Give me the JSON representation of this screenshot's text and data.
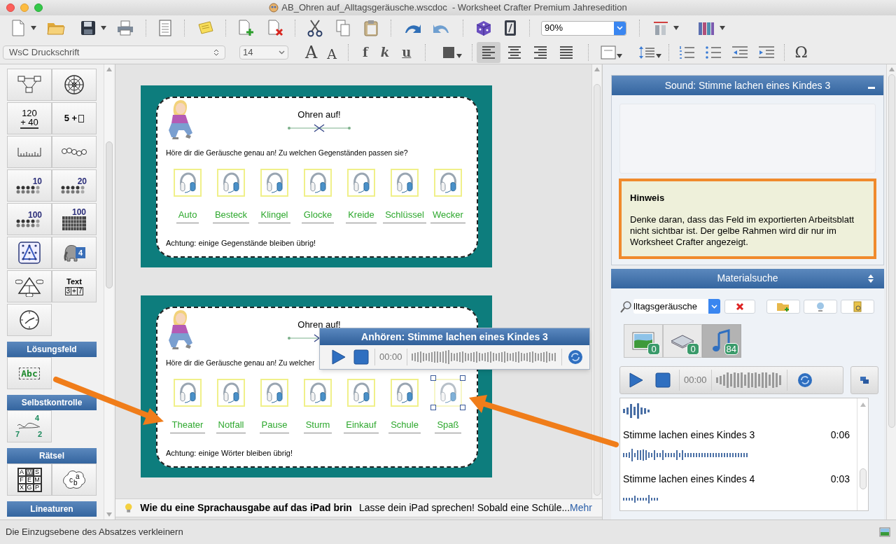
{
  "window": {
    "title": "AB_Ohren auf_Alltagsgeräusche.wscdoc  - Worksheet Crafter Premium Jahresedition"
  },
  "toolbar": {
    "zoom": "90%"
  },
  "format_bar": {
    "font": "WsC Druckschrift",
    "size": "14",
    "size_buttons": [
      "A",
      "A"
    ],
    "style_buttons": [
      "f",
      "k",
      "u"
    ],
    "align_buttons": [
      {
        "selected": true
      },
      {
        "selected": false
      },
      {
        "selected": false
      },
      {
        "selected": false
      }
    ],
    "special_char": "Ω"
  },
  "palette": {
    "tools": [
      {
        "kind": "flowchart"
      },
      {
        "kind": "wheel"
      },
      {
        "kind": "column-sum",
        "texts": [
          "120",
          "+ 40"
        ]
      },
      {
        "kind": "equation",
        "texts": [
          "5 +"
        ]
      },
      {
        "kind": "ruler"
      },
      {
        "kind": "beads"
      },
      {
        "kind": "dots",
        "texts": [
          "10"
        ]
      },
      {
        "kind": "dots",
        "texts": [
          "20"
        ]
      },
      {
        "kind": "dots",
        "texts": [
          "100"
        ]
      },
      {
        "kind": "grid",
        "texts": [
          "100"
        ]
      },
      {
        "kind": "geoboard"
      },
      {
        "kind": "elephant",
        "texts": [
          "4"
        ]
      },
      {
        "kind": "triangle"
      },
      {
        "kind": "text-task",
        "texts": [
          "Text",
          "3",
          "+",
          "7"
        ]
      },
      {
        "kind": "clock"
      }
    ],
    "sections": [
      {
        "title": "Lösungsfeld",
        "tools": [
          {
            "kind": "answer",
            "texts": [
              "Abc"
            ]
          }
        ]
      },
      {
        "title": "Selbstkontrolle",
        "tools": [
          {
            "kind": "self-check",
            "texts": [
              "4",
              "7",
              "2"
            ]
          }
        ]
      },
      {
        "title": "Rätsel",
        "tools": [
          {
            "kind": "letter-grid",
            "texts": [
              "A",
              "W",
              "S",
              "F",
              "E",
              "M",
              "X",
              "G",
              "P"
            ]
          },
          {
            "kind": "cloud",
            "texts": [
              "c",
              "b",
              "a"
            ]
          }
        ]
      },
      {
        "title": "Lineaturen"
      }
    ]
  },
  "worksheets": [
    {
      "title": "Ohren auf!",
      "instruction": "Höre dir die Geräusche genau an! Zu welchen Gegenständen passen sie?",
      "sound_fields": [
        {
          "selected": false
        },
        {
          "selected": false
        },
        {
          "selected": false
        },
        {
          "selected": false
        },
        {
          "selected": false
        },
        {
          "selected": false
        },
        {
          "selected": false
        }
      ],
      "words": [
        "Auto",
        "Besteck",
        "Klingel",
        "Glocke",
        "Kreide",
        "Schlüssel",
        "Wecker"
      ],
      "note": "Achtung: einige Gegenstände bleiben übrig!"
    },
    {
      "title": "Ohren auf!",
      "instruction": "Höre dir die Geräusche genau an! Zu welcher",
      "sound_fields": [
        {
          "selected": false
        },
        {
          "selected": false
        },
        {
          "selected": false
        },
        {
          "selected": false
        },
        {
          "selected": false
        },
        {
          "selected": false
        },
        {
          "selected": true
        }
      ],
      "words": [
        "Theater",
        "Notfall",
        "Pause",
        "Sturm",
        "Einkauf",
        "Schule",
        "Spaß"
      ],
      "note": "Achtung: einige Wörter bleiben übrig!"
    }
  ],
  "player_popup": {
    "title": "Anhören: Stimme lachen eines Kindes 3",
    "time": "00:00"
  },
  "tip": {
    "title": "Wie du eine Sprachausgabe auf das iPad brin",
    "text": "Lasse dein iPad sprechen! Sobald eine Schüle...",
    "link": "Mehr"
  },
  "sound_panel": {
    "title": "Sound: Stimme lachen eines Kindes 3",
    "hint": {
      "title": "Hinweis",
      "text": "Denke daran, dass das Feld im exportierten Arbeitsblatt nicht sichtbar ist. Der gelbe Rahmen wird dir nur im Worksheet Crafter angezeigt."
    }
  },
  "material_search": {
    "title": "Materialsuche",
    "query": "lltagsgeräusche",
    "categories": [
      {
        "kind": "images",
        "count": "0",
        "selected": false
      },
      {
        "kind": "books",
        "count": "0",
        "selected": false
      },
      {
        "kind": "sounds",
        "count": "84",
        "selected": true
      }
    ],
    "time": "00:00",
    "results": [
      {
        "name": "Stimme lachen eines Kindes 3",
        "duration": "0:06"
      },
      {
        "name": "Stimme lachen eines Kindes 4",
        "duration": "0:03"
      }
    ]
  },
  "status_bar": {
    "text": "Die Einzugsebene des Absatzes verkleinern"
  }
}
